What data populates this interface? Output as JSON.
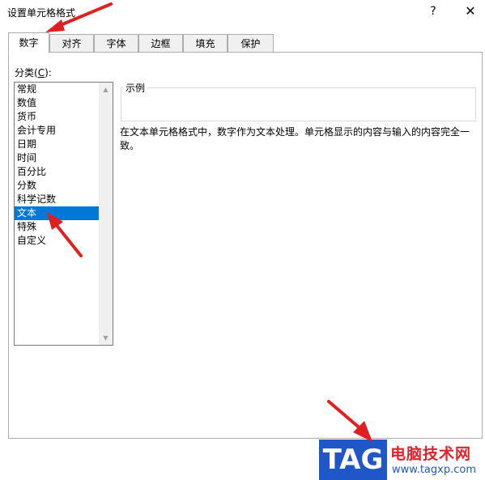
{
  "window": {
    "title": "设置单元格格式",
    "help_label": "?",
    "close_label": "✕"
  },
  "tabs": [
    {
      "label": "数字",
      "active": true
    },
    {
      "label": "对齐",
      "active": false
    },
    {
      "label": "字体",
      "active": false
    },
    {
      "label": "边框",
      "active": false
    },
    {
      "label": "填充",
      "active": false
    },
    {
      "label": "保护",
      "active": false
    }
  ],
  "category": {
    "label_prefix": "分类(",
    "label_accel": "C",
    "label_suffix": "):",
    "items": [
      "常规",
      "数值",
      "货币",
      "会计专用",
      "日期",
      "时间",
      "百分比",
      "分数",
      "科学记数",
      "文本",
      "特殊",
      "自定义"
    ],
    "selected": "文本"
  },
  "sample": {
    "label": "示例"
  },
  "description": "在文本单元格格式中，数字作为文本处理。单元格显示的内容与输入的内容完全一致。",
  "watermark": {
    "tag": "TAG",
    "site_name": "电脑技术网",
    "url": "www.tagxp.com"
  },
  "colors": {
    "selection": "#0078d7",
    "annotation_arrow": "#e02020",
    "watermark_blue": "#1f57c8",
    "watermark_red": "#e3212b"
  }
}
